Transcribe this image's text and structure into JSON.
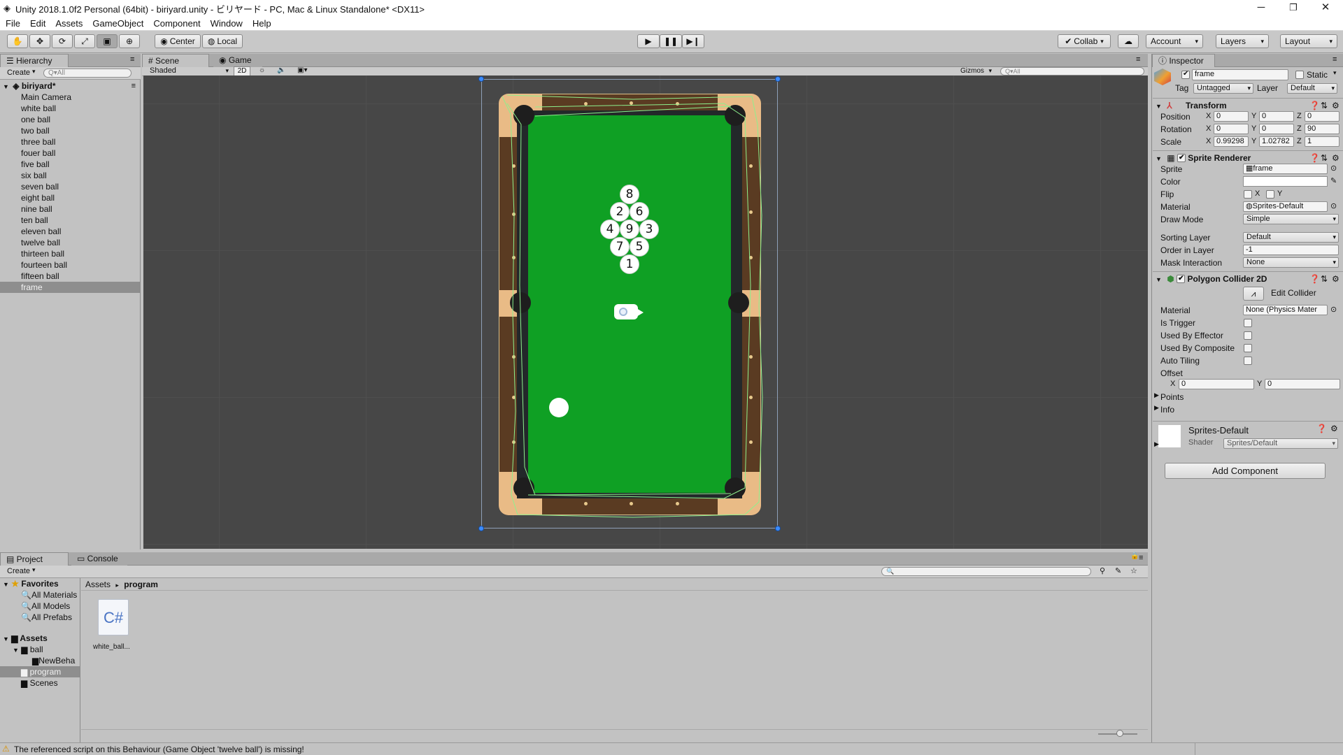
{
  "window": {
    "title": "Unity 2018.1.0f2 Personal (64bit) - biriyard.unity - ビリヤード - PC, Mac & Linux Standalone* <DX11>",
    "minimize": "─",
    "maximize": "❐",
    "close": "✕"
  },
  "menu": [
    "File",
    "Edit",
    "Assets",
    "GameObject",
    "Component",
    "Window",
    "Help"
  ],
  "toolbar": {
    "pivot": "Center",
    "space": "Local",
    "collab": "Collab",
    "account": "Account",
    "layers": "Layers",
    "layout": "Layout"
  },
  "hierarchy": {
    "tab": "Hierarchy",
    "create": "Create",
    "search_placeholder": "Q▾All",
    "scene_name": "biriyard*",
    "items": [
      "Main Camera",
      "white ball",
      "one ball",
      "two ball",
      "three ball",
      "fouer ball",
      "five ball",
      "six ball",
      "seven ball",
      "eight ball",
      "nine ball",
      "ten ball",
      "eleven ball",
      "twelve ball",
      "thirteen ball",
      "fourteen ball",
      "fifteen ball",
      "frame"
    ],
    "selected": "frame"
  },
  "scene": {
    "tab_scene": "Scene",
    "tab_game": "Game",
    "shading": "Shaded",
    "mode_2d": "2D",
    "gizmos": "Gizmos",
    "search_placeholder": "Q▾All",
    "balls": [
      "8",
      "2",
      "6",
      "4",
      "9",
      "3",
      "7",
      "5",
      "1"
    ]
  },
  "inspector": {
    "tab": "Inspector",
    "object_name": "frame",
    "static_label": "Static",
    "tag_label": "Tag",
    "tag_value": "Untagged",
    "layer_label": "Layer",
    "layer_value": "Default",
    "transform": {
      "title": "Transform",
      "position_label": "Position",
      "rotation_label": "Rotation",
      "scale_label": "Scale",
      "position": {
        "x": "0",
        "y": "0",
        "z": "0"
      },
      "rotation": {
        "x": "0",
        "y": "0",
        "z": "90"
      },
      "scale": {
        "x": "0.99298",
        "y": "1.02782",
        "z": "1"
      }
    },
    "sprite_renderer": {
      "title": "Sprite Renderer",
      "sprite_label": "Sprite",
      "sprite_value": "frame",
      "color_label": "Color",
      "flip_label": "Flip",
      "flip_x": "X",
      "flip_y": "Y",
      "material_label": "Material",
      "material_value": "Sprites-Default",
      "draw_mode_label": "Draw Mode",
      "draw_mode_value": "Simple",
      "sorting_layer_label": "Sorting Layer",
      "sorting_layer_value": "Default",
      "order_label": "Order in Layer",
      "order_value": "-1",
      "mask_label": "Mask Interaction",
      "mask_value": "None"
    },
    "polygon_collider": {
      "title": "Polygon Collider 2D",
      "edit_collider": "Edit Collider",
      "material_label": "Material",
      "material_value": "None (Physics Mater",
      "is_trigger": "Is Trigger",
      "used_by_effector": "Used By Effector",
      "used_by_composite": "Used By Composite",
      "auto_tiling": "Auto Tiling",
      "offset_label": "Offset",
      "offset": {
        "x": "0",
        "y": "0"
      },
      "points": "Points",
      "info": "Info"
    },
    "material_preview": {
      "name": "Sprites-Default",
      "shader_label": "Shader",
      "shader_value": "Sprites/Default"
    },
    "add_component": "Add Component"
  },
  "project": {
    "tab_project": "Project",
    "tab_console": "Console",
    "create": "Create",
    "favorites": "Favorites",
    "fav_items": [
      "All Materials",
      "All Models",
      "All Prefabs"
    ],
    "assets": "Assets",
    "asset_tree": [
      "ball",
      "NewBeha",
      "program",
      "Scenes"
    ],
    "selected_folder": "program",
    "breadcrumb": [
      "Assets",
      "program"
    ],
    "files": [
      {
        "name": "white_ball...",
        "icon": "C#"
      }
    ]
  },
  "status": {
    "message": "The referenced script on this Behaviour (Game Object 'twelve ball') is missing!"
  }
}
